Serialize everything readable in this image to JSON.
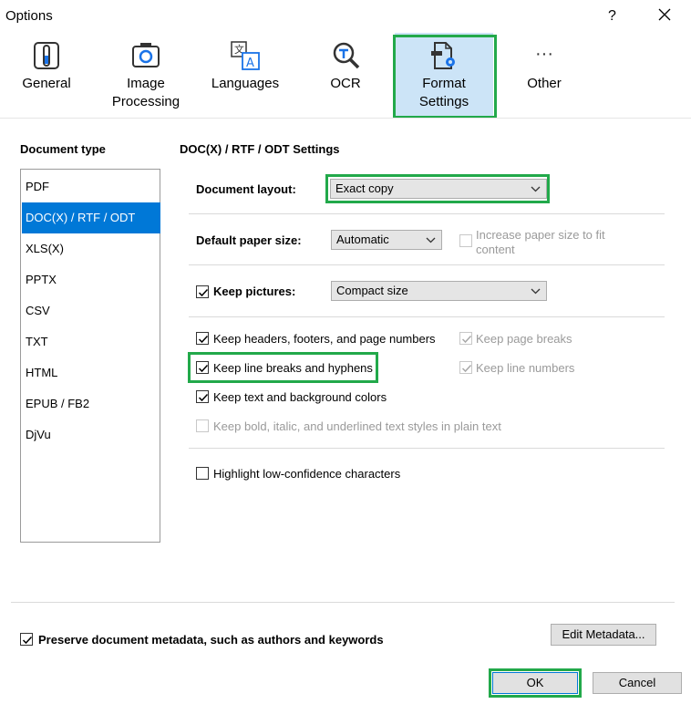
{
  "window": {
    "title": "Options",
    "help_glyph": "?",
    "close_glyph": "✕"
  },
  "toolbar": {
    "items": [
      {
        "label_lines": [
          "General"
        ],
        "icon": "general-icon"
      },
      {
        "label_lines": [
          "Image",
          "Processing"
        ],
        "icon": "image-processing-icon"
      },
      {
        "label_lines": [
          "Languages"
        ],
        "icon": "languages-icon"
      },
      {
        "label_lines": [
          "OCR"
        ],
        "icon": "ocr-icon"
      },
      {
        "label_lines": [
          "Format",
          "Settings"
        ],
        "icon": "format-settings-icon",
        "selected": true
      },
      {
        "label_lines": [
          "Other"
        ],
        "icon": "more-icon"
      }
    ],
    "more_glyph": "···"
  },
  "sidebar": {
    "title": "Document type",
    "items": [
      "PDF",
      "DOC(X) / RTF / ODT",
      "XLS(X)",
      "PPTX",
      "CSV",
      "TXT",
      "HTML",
      "EPUB / FB2",
      "DjVu"
    ],
    "selected_index": 1
  },
  "settings": {
    "title": "DOC(X) / RTF / ODT Settings",
    "document_layout_label": "Document layout:",
    "document_layout_value": "Exact copy",
    "paper_size_label": "Default paper size:",
    "paper_size_value": "Automatic",
    "increase_paper_line1": "Increase paper size to fit",
    "increase_paper_line2": "content",
    "keep_pictures_label": "Keep pictures:",
    "keep_pictures_value": "Compact size",
    "keep_headers": "Keep headers, footers, and page numbers",
    "keep_page_breaks": "Keep page breaks",
    "keep_line_breaks": "Keep line breaks and hyphens",
    "keep_line_numbers": "Keep line numbers",
    "keep_colors": "Keep text and background colors",
    "keep_styles": "Keep bold, italic, and underlined text styles in plain text",
    "highlight_low_conf": "Highlight low-confidence characters"
  },
  "footer": {
    "preserve_metadata": "Preserve document metadata, such as authors and keywords",
    "edit_metadata": "Edit Metadata...",
    "ok": "OK",
    "cancel": "Cancel"
  },
  "colors": {
    "accent": "#0078d7",
    "selected_tab": "#cce4f7",
    "highlight": "#22a94a"
  }
}
